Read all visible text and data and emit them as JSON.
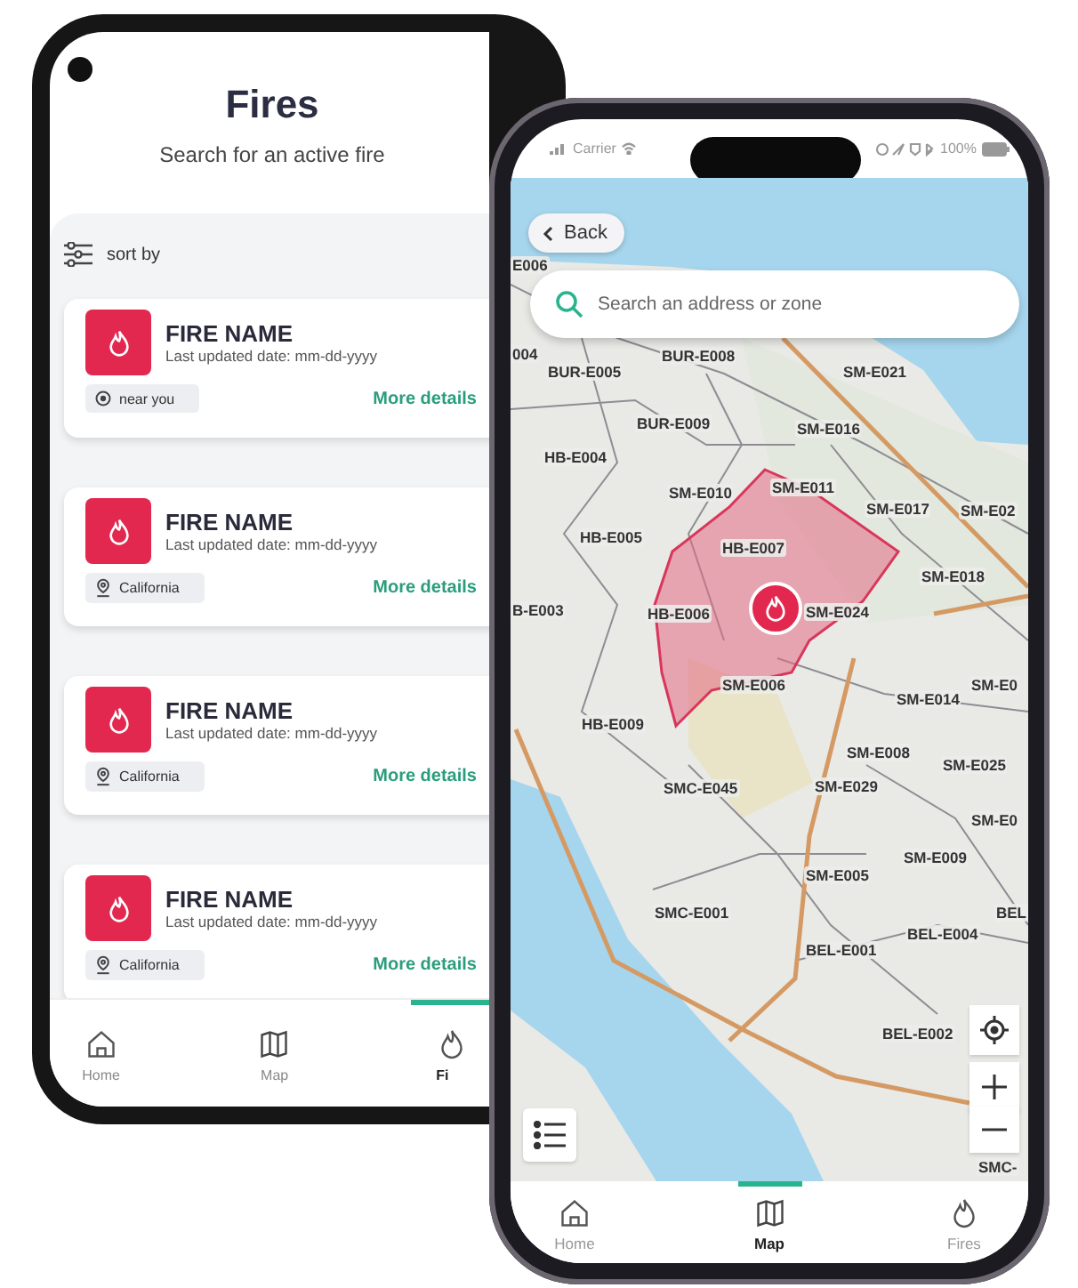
{
  "fires_screen": {
    "title": "Fires",
    "subtitle": "Search for an active fire",
    "sort_label": "sort by",
    "cards": [
      {
        "name": "FIRE NAME",
        "updated": "Last updated date: mm-dd-yyyy",
        "location": {
          "kind": "nearby",
          "label": "near you"
        },
        "link": "More details"
      },
      {
        "name": "FIRE NAME",
        "updated": "Last updated date: mm-dd-yyyy",
        "location": {
          "kind": "place",
          "label": "California"
        },
        "link": "More details"
      },
      {
        "name": "FIRE NAME",
        "updated": "Last updated date: mm-dd-yyyy",
        "location": {
          "kind": "place",
          "label": "California"
        },
        "link": "More details"
      },
      {
        "name": "FIRE NAME",
        "updated": "Last updated date: mm-dd-yyyy",
        "location": {
          "kind": "place",
          "label": "California"
        },
        "link": "More details"
      }
    ],
    "tabs": [
      {
        "kind": "home",
        "label": "Home",
        "selected": false
      },
      {
        "kind": "map",
        "label": "Map",
        "selected": false
      },
      {
        "kind": "flame",
        "label": "Fi",
        "selected": true
      }
    ]
  },
  "map_screen": {
    "status_bar": {
      "carrier": "Carrier",
      "battery": "100%"
    },
    "back_button": "Back",
    "search": {
      "placeholder": "Search an address or zone"
    },
    "zone_labels": [
      "E006",
      "004",
      "BUR-E005",
      "BUR-E008",
      "SM-E021",
      "BUR-E009",
      "SM-E016",
      "HB-E004",
      "SM-E010",
      "SM-E011",
      "SM-E017",
      "SM-E02",
      "HB-E005",
      "HB-E007",
      "SM-E018",
      "B-E003",
      "HB-E006",
      "SM-E024",
      "SM-E006",
      "SM-E014",
      "SM-E0",
      "HB-E009",
      "SM-E008",
      "SM-E025",
      "SMC-E045",
      "SM-E029",
      "SM-E0",
      "SM-E009",
      "SM-E005",
      "SMC-E001",
      "BEL",
      "BEL-E004",
      "BEL-E001",
      "BEL-E002",
      "SMC-"
    ],
    "tabs": [
      {
        "kind": "home",
        "label": "Home",
        "selected": false
      },
      {
        "kind": "map",
        "label": "Map",
        "selected": true
      },
      {
        "kind": "flame",
        "label": "Fires",
        "selected": false
      }
    ]
  }
}
